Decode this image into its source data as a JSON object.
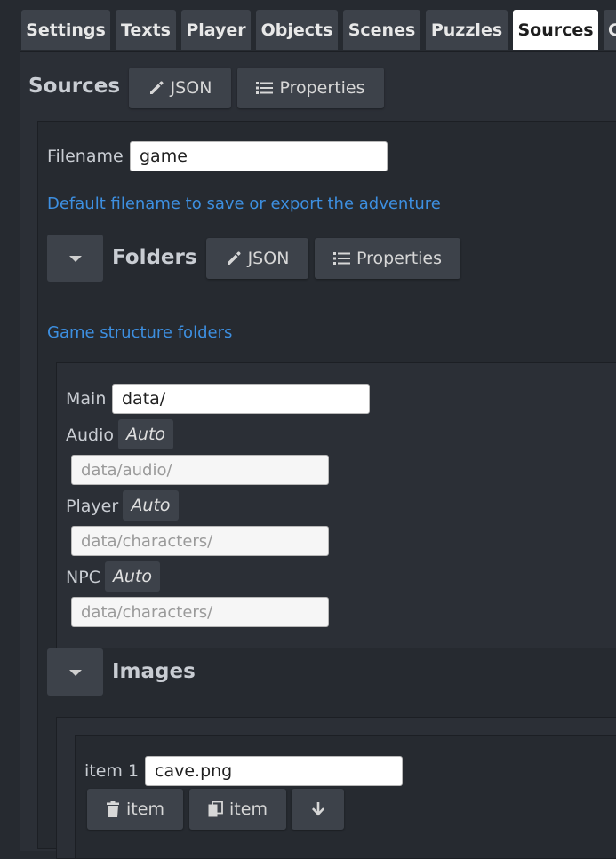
{
  "tabs": [
    "Settings",
    "Texts",
    "Player",
    "Objects",
    "Scenes",
    "Puzzles",
    "Sources",
    "C"
  ],
  "active_tab": "Sources",
  "sources": {
    "title": "Sources",
    "json_label": "JSON",
    "properties_label": "Properties",
    "filename_label": "Filename",
    "filename_value": "game",
    "filename_hint": "Default filename to save or export the adventure"
  },
  "folders": {
    "title": "Folders",
    "json_label": "JSON",
    "properties_label": "Properties",
    "hint": "Game structure folders",
    "main_label": "Main",
    "main_value": "data/",
    "audio_label": "Audio",
    "audio_auto": "Auto",
    "audio_placeholder": "data/audio/",
    "player_label": "Player",
    "player_auto": "Auto",
    "player_placeholder": "data/characters/",
    "npc_label": "NPC",
    "npc_auto": "Auto",
    "npc_placeholder": "data/characters/"
  },
  "images": {
    "title": "Images",
    "item_label": "item 1",
    "item_value": "cave.png",
    "delete_label": "item",
    "copy_label": "item"
  },
  "colors": {
    "background": "#262a30",
    "button": "#3d424a",
    "hint": "#3d8fe0",
    "active_tab": "#ffffff"
  }
}
